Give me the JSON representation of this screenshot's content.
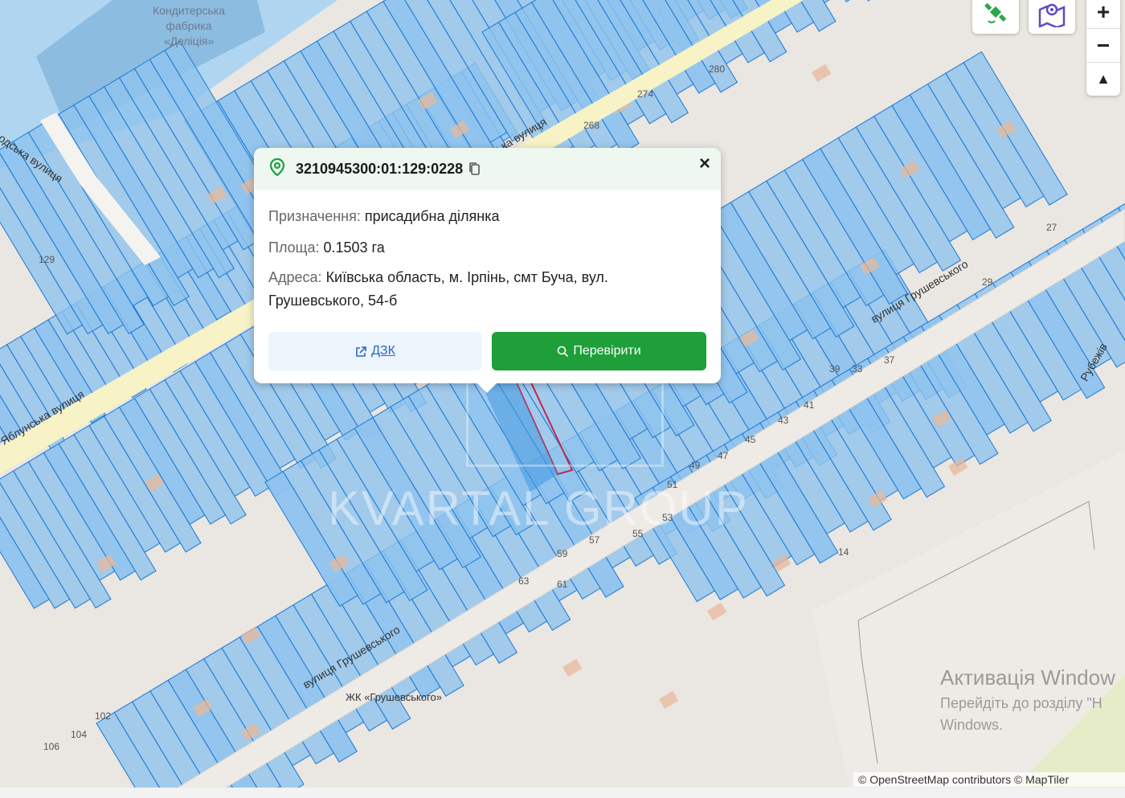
{
  "map": {
    "labels": {
      "factory": [
        "Кондитерська",
        "фабрика",
        "«Деліція»"
      ],
      "streets": [
        "вулиця Грушевського",
        "вулиця Грушевського",
        "Яблунська вулиця",
        "ська вулиця",
        "одська вулиця",
        "Рубежів"
      ],
      "complex": "ЖК «Грушевського»",
      "numbers": [
        "274",
        "280",
        "268",
        "129",
        "27",
        "29",
        "33",
        "37",
        "39",
        "41",
        "43",
        "45",
        "47",
        "49",
        "51",
        "53",
        "55",
        "57",
        "59",
        "61",
        "63",
        "14",
        "102",
        "104",
        "106"
      ]
    },
    "watermark": "KVARTAL GROUP",
    "colors": {
      "parcel_fill": "#8fc3ee",
      "parcel_stroke": "#1a78d6",
      "road": "#f7f3c6",
      "selected": "#c0284a",
      "base": "#eae6e1"
    }
  },
  "controls": {
    "layer_icon": "satellite-icon",
    "map_icon": "map-icon",
    "zoom_in": "+",
    "zoom_out": "−",
    "compass": "▲"
  },
  "popup": {
    "cadastral": "3210945300:01:129:0228",
    "purpose_label": "Призначення:",
    "purpose_value": "присадибна ділянка",
    "area_label": "Площа:",
    "area_value": "0.1503 га",
    "address_label": "Адреса:",
    "address_value": "Київська область, м. Ірпінь, смт Буча, вул. Грушевського, 54-б",
    "dzk_button": "ДЗК",
    "check_button": "Перевірити"
  },
  "overlay": {
    "activate_title": "Активація Window",
    "activate_line1": "Перейдіть до розділу \"Н",
    "activate_line2": "Windows."
  },
  "attribution": "© OpenStreetMap contributors  © MapTiler"
}
